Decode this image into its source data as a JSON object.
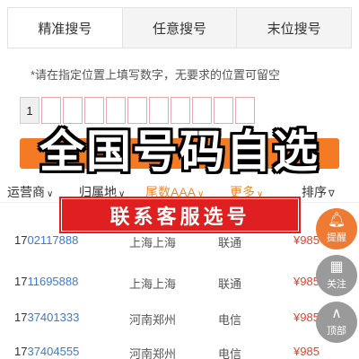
{
  "tabs": [
    {
      "label": "精准搜号"
    },
    {
      "label": "任意搜号"
    },
    {
      "label": "末位搜号"
    }
  ],
  "hint": "*请在指定位置上填写数字，无要求的位置可留空",
  "digits": [
    "1",
    "",
    "",
    "",
    "",
    "",
    "",
    "",
    "",
    "",
    ""
  ],
  "banner": "全国号码自选",
  "filters": [
    {
      "label": "运营商",
      "caret": "∨"
    },
    {
      "label": "归属地",
      "caret": "∨"
    },
    {
      "label": "尾数AAA",
      "caret": "∨"
    },
    {
      "label": "更多",
      "caret": "∨"
    },
    {
      "label": "排序",
      "caret": "∇"
    }
  ],
  "service_banner": "联系客服选号",
  "rows": [
    {
      "prefix": "17",
      "highlight": "02117888",
      "area": "上海上海",
      "carrier": "联通",
      "price": "¥985"
    },
    {
      "prefix": "17",
      "highlight": "11695888",
      "area": "上海上海",
      "carrier": "联通",
      "price": "¥985"
    },
    {
      "prefix": "17",
      "highlight": "37401333",
      "area": "河南郑州",
      "carrier": "电信",
      "price": "¥985"
    },
    {
      "prefix": "17",
      "highlight": "37404555",
      "area": "河南郑州",
      "carrier": "电信",
      "price": "¥985"
    }
  ],
  "side": {
    "remind": {
      "label": "提醒",
      "icon": "bell-icon"
    },
    "follow": {
      "label": "关注",
      "icon": "qr-icon"
    },
    "top": {
      "label": "顶部",
      "icon": "chevron-up-icon"
    }
  },
  "colors": {
    "accent": "#f47b24",
    "price": "#e5432a",
    "highlight": "#3a7bd5",
    "service": "#e02020"
  }
}
